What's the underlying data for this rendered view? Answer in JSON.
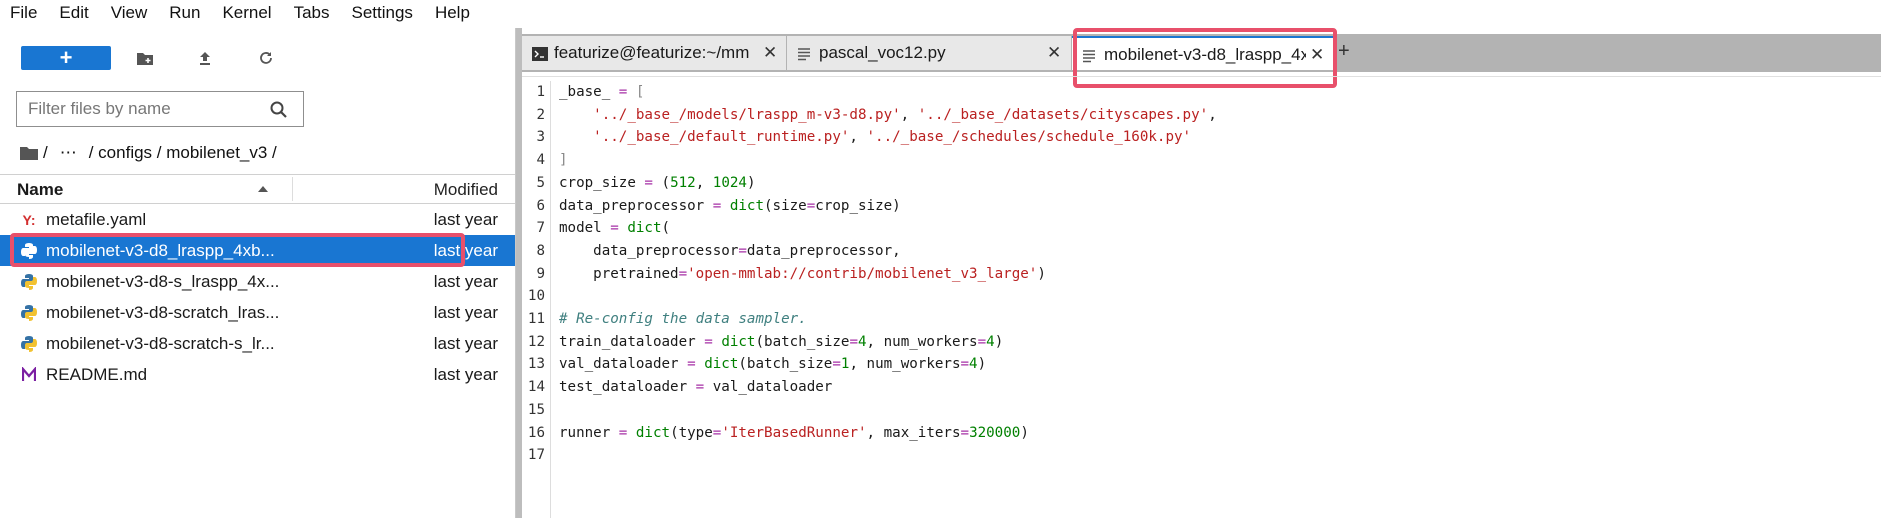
{
  "menubar": {
    "items": [
      "File",
      "Edit",
      "View",
      "Run",
      "Kernel",
      "Tabs",
      "Settings",
      "Help"
    ]
  },
  "filebrowser": {
    "new_button_label": "+",
    "filter_placeholder": "Filter files by name",
    "breadcrumb": [
      "/",
      "⋯",
      "/ configs / mobilenet_v3 /"
    ],
    "columns": {
      "name": "Name",
      "modified": "Modified"
    },
    "files": [
      {
        "name": "metafile.yaml",
        "modified": "last year",
        "icon": "yaml-icon",
        "selected": false
      },
      {
        "name": "mobilenet-v3-d8_lraspp_4xb...",
        "modified": "last year",
        "icon": "python-icon",
        "selected": true
      },
      {
        "name": "mobilenet-v3-d8-s_lraspp_4x...",
        "modified": "last year",
        "icon": "python-icon",
        "selected": false
      },
      {
        "name": "mobilenet-v3-d8-scratch_lras...",
        "modified": "last year",
        "icon": "python-icon",
        "selected": false
      },
      {
        "name": "mobilenet-v3-d8-scratch-s_lr...",
        "modified": "last year",
        "icon": "python-icon",
        "selected": false
      },
      {
        "name": "README.md",
        "modified": "last year",
        "icon": "markdown-icon",
        "selected": false
      }
    ]
  },
  "tabs": [
    {
      "label": "featurize@featurize:~/mm",
      "icon": "terminal-icon",
      "active": false
    },
    {
      "label": "pascal_voc12.py",
      "icon": "file-text-icon",
      "active": false
    },
    {
      "label": "mobilenet-v3-d8_lraspp_4x",
      "icon": "file-text-icon",
      "active": true
    }
  ],
  "add_tab_label": "+",
  "close_glyph": "✕",
  "code_lines": [
    [
      [
        "t",
        "_base_ "
      ],
      [
        "op",
        "="
      ],
      [
        "t",
        " "
      ],
      [
        "br",
        "["
      ]
    ],
    [
      [
        "t",
        "    "
      ],
      [
        "s",
        "'../_base_/models/lraspp_m-v3-d8.py'"
      ],
      [
        "t",
        ", "
      ],
      [
        "s",
        "'../_base_/datasets/cityscapes.py'"
      ],
      [
        "t",
        ","
      ]
    ],
    [
      [
        "t",
        "    "
      ],
      [
        "s",
        "'../_base_/default_runtime.py'"
      ],
      [
        "t",
        ", "
      ],
      [
        "s",
        "'../_base_/schedules/schedule_160k.py'"
      ]
    ],
    [
      [
        "br",
        "]"
      ]
    ],
    [
      [
        "t",
        "crop_size "
      ],
      [
        "op",
        "="
      ],
      [
        "t",
        " ("
      ],
      [
        "n",
        "512"
      ],
      [
        "t",
        ", "
      ],
      [
        "n",
        "1024"
      ],
      [
        "t",
        ")"
      ]
    ],
    [
      [
        "t",
        "data_preprocessor "
      ],
      [
        "op",
        "="
      ],
      [
        "t",
        " "
      ],
      [
        "f",
        "dict"
      ],
      [
        "t",
        "(size"
      ],
      [
        "op",
        "="
      ],
      [
        "t",
        "crop_size)"
      ]
    ],
    [
      [
        "t",
        "model "
      ],
      [
        "op",
        "="
      ],
      [
        "t",
        " "
      ],
      [
        "f",
        "dict"
      ],
      [
        "t",
        "("
      ]
    ],
    [
      [
        "t",
        "    data_preprocessor"
      ],
      [
        "op",
        "="
      ],
      [
        "t",
        "data_preprocessor,"
      ]
    ],
    [
      [
        "t",
        "    pretrained"
      ],
      [
        "op",
        "="
      ],
      [
        "s",
        "'open-mmlab://contrib/mobilenet_v3_large'"
      ],
      [
        "t",
        ")"
      ]
    ],
    [
      [
        "t",
        ""
      ]
    ],
    [
      [
        "c",
        "# Re-config the data sampler."
      ]
    ],
    [
      [
        "t",
        "train_dataloader "
      ],
      [
        "op",
        "="
      ],
      [
        "t",
        " "
      ],
      [
        "f",
        "dict"
      ],
      [
        "t",
        "(batch_size"
      ],
      [
        "op",
        "="
      ],
      [
        "n",
        "4"
      ],
      [
        "t",
        ", num_workers"
      ],
      [
        "op",
        "="
      ],
      [
        "n",
        "4"
      ],
      [
        "t",
        ")"
      ]
    ],
    [
      [
        "t",
        "val_dataloader "
      ],
      [
        "op",
        "="
      ],
      [
        "t",
        " "
      ],
      [
        "f",
        "dict"
      ],
      [
        "t",
        "(batch_size"
      ],
      [
        "op",
        "="
      ],
      [
        "n",
        "1"
      ],
      [
        "t",
        ", num_workers"
      ],
      [
        "op",
        "="
      ],
      [
        "n",
        "4"
      ],
      [
        "t",
        ")"
      ]
    ],
    [
      [
        "t",
        "test_dataloader "
      ],
      [
        "op",
        "="
      ],
      [
        "t",
        " val_dataloader"
      ]
    ],
    [
      [
        "t",
        ""
      ]
    ],
    [
      [
        "t",
        "runner "
      ],
      [
        "op",
        "="
      ],
      [
        "t",
        " "
      ],
      [
        "f",
        "dict"
      ],
      [
        "t",
        "(type"
      ],
      [
        "op",
        "="
      ],
      [
        "s",
        "'IterBasedRunner'"
      ],
      [
        "t",
        ", max_iters"
      ],
      [
        "op",
        "="
      ],
      [
        "n",
        "320000"
      ],
      [
        "t",
        ")"
      ]
    ],
    [
      [
        "t",
        ""
      ]
    ]
  ],
  "colors": {
    "accent": "#1976d2",
    "highlight": "#e8506b",
    "string": "#ba2121",
    "number": "#008000",
    "operator": "#a630a6",
    "comment": "#408080"
  }
}
